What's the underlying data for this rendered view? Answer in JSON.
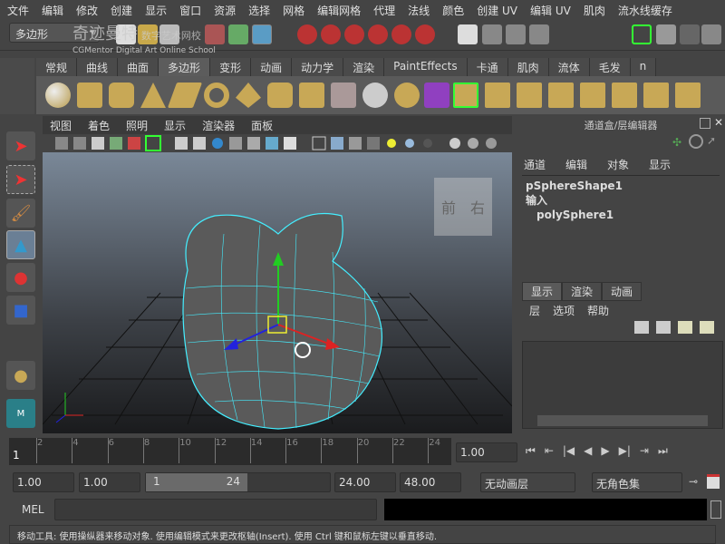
{
  "menubar": [
    "文件",
    "编辑",
    "修改",
    "创建",
    "显示",
    "窗口",
    "资源",
    "选择",
    "网格",
    "编辑网格",
    "代理",
    "法线",
    "颜色",
    "创建 UV",
    "编辑 UV",
    "肌肉",
    "流水线缓存"
  ],
  "menu_mode": "多边形",
  "watermark": {
    "title": "奇迹曼特",
    "subtitle": "数字艺术网校",
    "english": "CGMentor Digital Art Online School"
  },
  "shelf_tabs": [
    "常规",
    "曲线",
    "曲面",
    "多边形",
    "变形",
    "动画",
    "动力学",
    "渲染",
    "PaintEffects",
    "卡通",
    "肌肉",
    "流体",
    "毛发",
    "n"
  ],
  "active_shelf": "多边形",
  "viewport": {
    "menu": [
      "视图",
      "着色",
      "照明",
      "显示",
      "渲染器",
      "面板"
    ],
    "viewcube": {
      "front": "前",
      "right": "右"
    }
  },
  "channel_box": {
    "title": "通道盒/层编辑器",
    "menu": [
      "通道",
      "编辑",
      "对象",
      "显示"
    ],
    "shape": "pSphereShape1",
    "inputs_label": "输入",
    "input": "polySphere1"
  },
  "layer_editor": {
    "tabs": [
      "显示",
      "渲染",
      "动画"
    ],
    "menu": [
      "层",
      "选项",
      "帮助"
    ]
  },
  "timeline": {
    "ticks": [
      "2",
      "4",
      "6",
      "8",
      "10",
      "12",
      "14",
      "16",
      "18",
      "20",
      "22",
      "24"
    ],
    "current": "1",
    "current_time": "1.00"
  },
  "range": {
    "start": "1.00",
    "playback_start": "1.00",
    "slider_start": "1",
    "slider_end": "24",
    "playback_end": "24.00",
    "end": "48.00",
    "anim_layer": "无动画层",
    "char_set": "无角色集"
  },
  "command": {
    "label": "MEL"
  },
  "help_line": "移动工具: 使用操纵器来移动对象. 使用编辑模式来更改枢轴(Insert). 使用 Ctrl 键和鼠标左键以垂直移动."
}
